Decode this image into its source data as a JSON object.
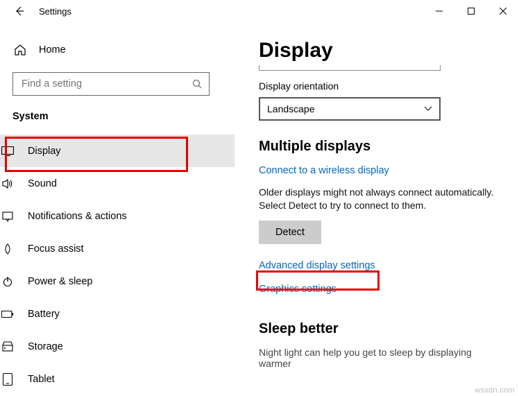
{
  "window": {
    "title": "Settings"
  },
  "sidebar": {
    "home": "Home",
    "search_placeholder": "Find a setting",
    "category": "System",
    "items": [
      {
        "label": "Display",
        "selected": true
      },
      {
        "label": "Sound"
      },
      {
        "label": "Notifications & actions"
      },
      {
        "label": "Focus assist"
      },
      {
        "label": "Power & sleep"
      },
      {
        "label": "Battery"
      },
      {
        "label": "Storage"
      },
      {
        "label": "Tablet"
      }
    ]
  },
  "content": {
    "page_title": "Display",
    "orientation_label": "Display orientation",
    "orientation_value": "Landscape",
    "multiple_displays_heading": "Multiple displays",
    "connect_wireless_link": "Connect to a wireless display",
    "older_displays_text": "Older displays might not always connect automatically. Select Detect to try to connect to them.",
    "detect_button": "Detect",
    "advanced_link": "Advanced display settings",
    "graphics_link": "Graphics settings",
    "sleep_better_heading": "Sleep better",
    "night_light_text": "Night light can help you get to sleep by displaying warmer"
  },
  "watermark": "wsxdn.com"
}
